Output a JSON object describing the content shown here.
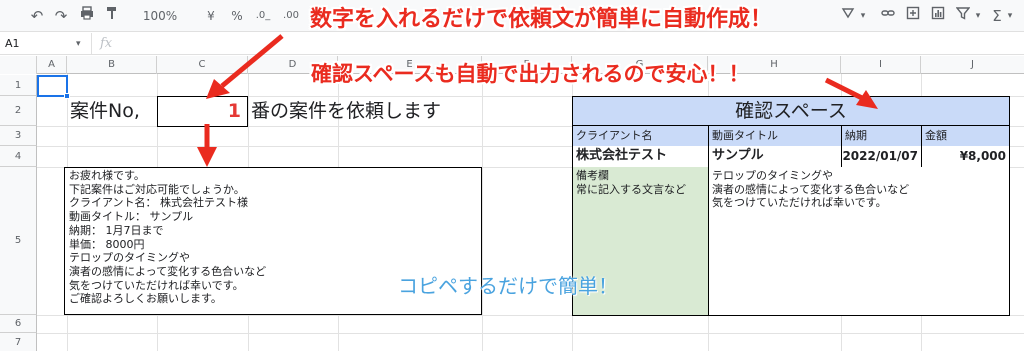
{
  "toolbar": {
    "zoom": "100%",
    "currency": "¥",
    "percent": "%",
    "dec_decrease": ".0_",
    "dec_increase": ".00",
    "sigma": "Σ"
  },
  "formula_bar": {
    "cell_ref": "A1",
    "fx": "fx",
    "value": ""
  },
  "columns": [
    "A",
    "B",
    "C",
    "D",
    "E",
    "F",
    "G",
    "H",
    "I",
    "J"
  ],
  "rows": [
    "1",
    "2",
    "3",
    "4",
    "5",
    "6",
    "7"
  ],
  "case_line": {
    "label": "案件No,",
    "number": "1",
    "suffix": "番の案件を依頼します"
  },
  "message_lines": [
    "お疲れ様です。",
    "下記案件はご対応可能でしょうか。",
    "クライアント名： 株式会社テスト様",
    "動画タイトル： サンプル",
    "納期： 1月7日まで",
    "単価： 8000円",
    "テロップのタイミングや",
    "演者の感情によって変化する色合いなど",
    "気をつけていただければ幸いです。",
    "ご確認よろしくお願いします。"
  ],
  "confirm": {
    "title": "確認スペース",
    "headers": [
      "クライアント名",
      "動画タイトル",
      "納期",
      "金額"
    ],
    "values": [
      "株式会社テスト",
      "サンプル",
      "2022/01/07",
      "¥8,000"
    ],
    "notes_label_lines": [
      "備考欄",
      "常に記入する文言など"
    ],
    "notes_lines": [
      "テロップのタイミングや",
      "演者の感情によって変化する色合いなど",
      "気をつけていただければ幸いです。"
    ]
  },
  "annotations": {
    "top": "数字を入れるだけで依頼文が簡単に自動作成！",
    "middle": "確認スペースも自動で出力されるので安心！！",
    "bottom": "コピペするだけで簡単！"
  },
  "colors": {
    "annotation_red": "#ea2b1f",
    "header_blue": "#c9daf8",
    "notes_green": "#d9ead3",
    "number_red": "#e53935",
    "copy_blue": "#4aa3df"
  }
}
